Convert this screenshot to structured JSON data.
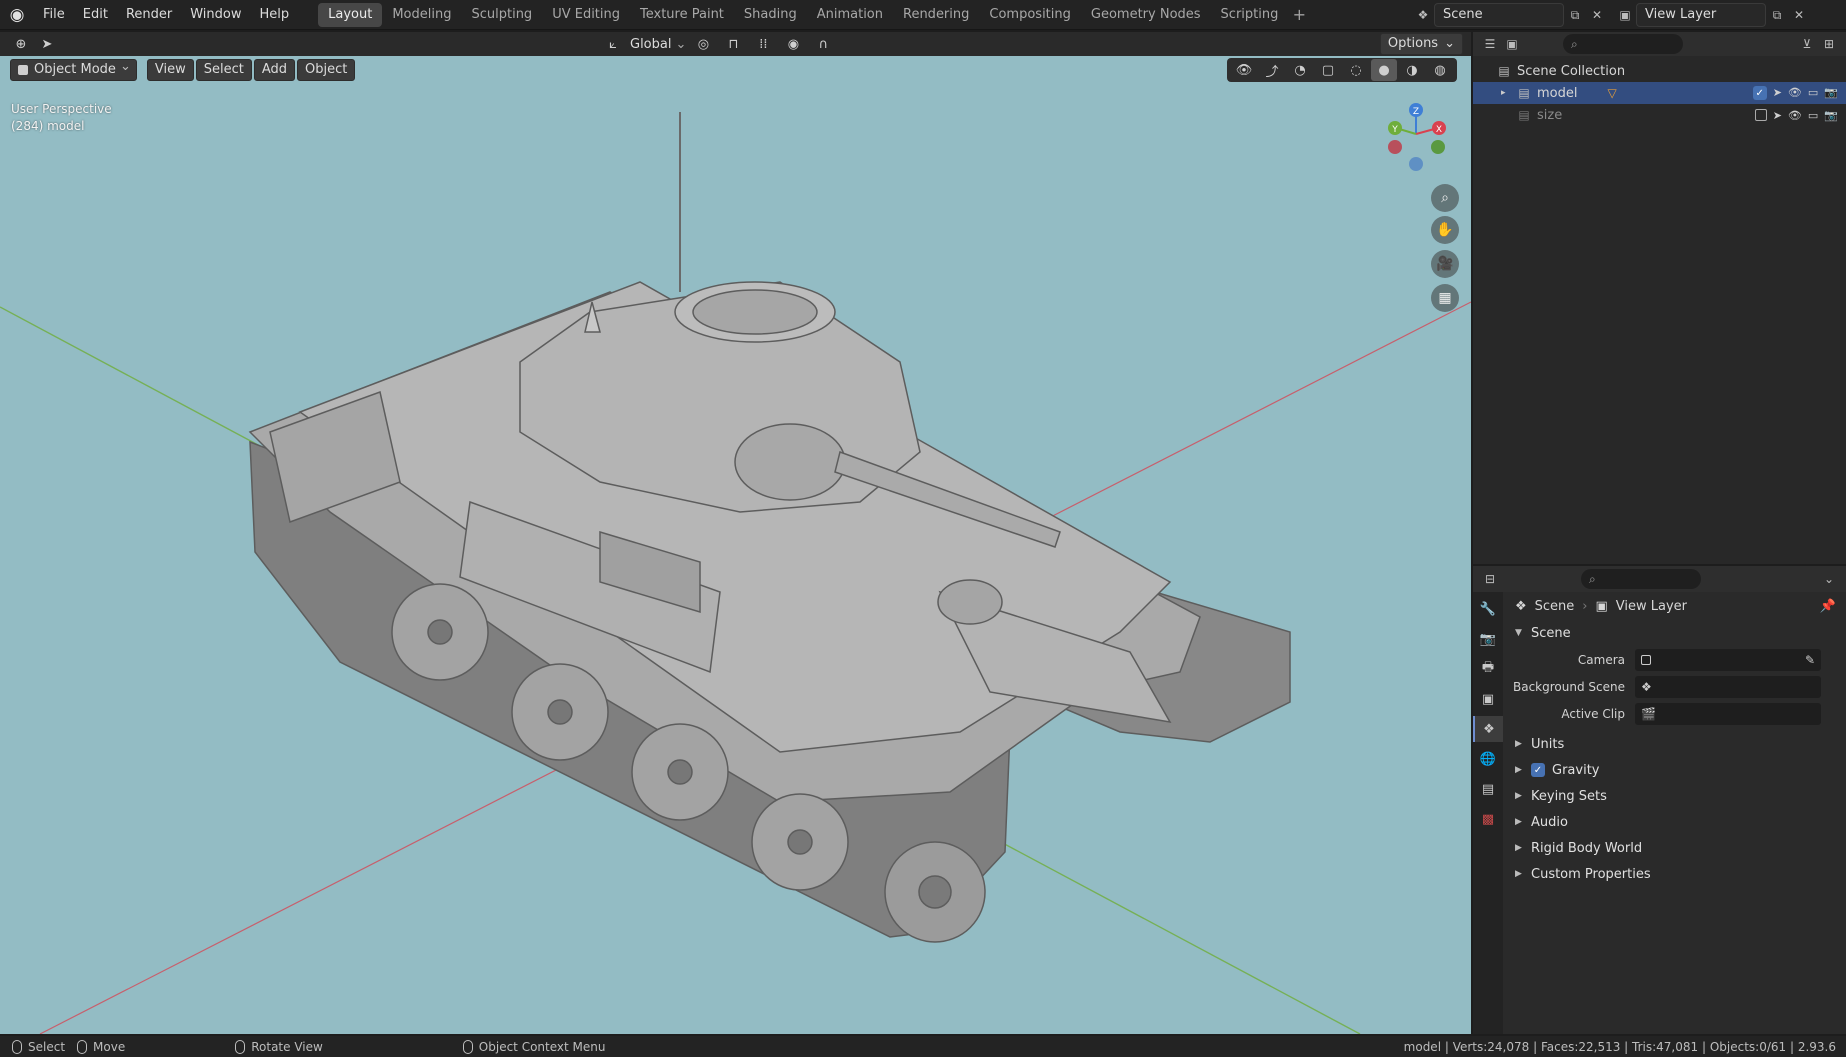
{
  "topbar": {
    "menus": [
      "File",
      "Edit",
      "Render",
      "Window",
      "Help"
    ],
    "workspaces": [
      "Layout",
      "Modeling",
      "Sculpting",
      "UV Editing",
      "Texture Paint",
      "Shading",
      "Animation",
      "Rendering",
      "Compositing",
      "Geometry Nodes",
      "Scripting"
    ],
    "active_workspace": "Layout",
    "scene": "Scene",
    "view_layer": "View Layer"
  },
  "viewport": {
    "transform_orientation": "Global",
    "options_label": "Options",
    "mode": "Object Mode",
    "menus": [
      "View",
      "Select",
      "Add",
      "Object"
    ],
    "perspective_label": "User Perspective",
    "object_label": "(284) model",
    "gizmo_axes": {
      "x": "X",
      "y": "Y",
      "z": "Z"
    }
  },
  "outliner": {
    "collection": "Scene Collection",
    "items": [
      {
        "name": "model",
        "selected": true
      },
      {
        "name": "size",
        "selected": false
      }
    ]
  },
  "properties": {
    "breadcrumb_scene": "Scene",
    "breadcrumb_view_layer": "View Layer",
    "panel_title": "Scene",
    "fields": [
      {
        "label": "Camera"
      },
      {
        "label": "Background Scene"
      },
      {
        "label": "Active Clip"
      }
    ],
    "subpanels": [
      "Units",
      "Gravity",
      "Keying Sets",
      "Audio",
      "Rigid Body World",
      "Custom Properties"
    ]
  },
  "statusbar": {
    "select": "Select",
    "move": "Move",
    "rotate": "Rotate View",
    "context": "Object Context Menu",
    "stats": "model | Verts:24,078 | Faces:22,513 | Tris:47,081 | Objects:0/61 | 2.93.6"
  },
  "colors": {
    "viewport_bg": "#93bcc4",
    "selection": "#334d80",
    "accent": "#4772b3",
    "axis_x": "#d9414f",
    "axis_y": "#6fae3b",
    "axis_z": "#3f7fd6"
  }
}
